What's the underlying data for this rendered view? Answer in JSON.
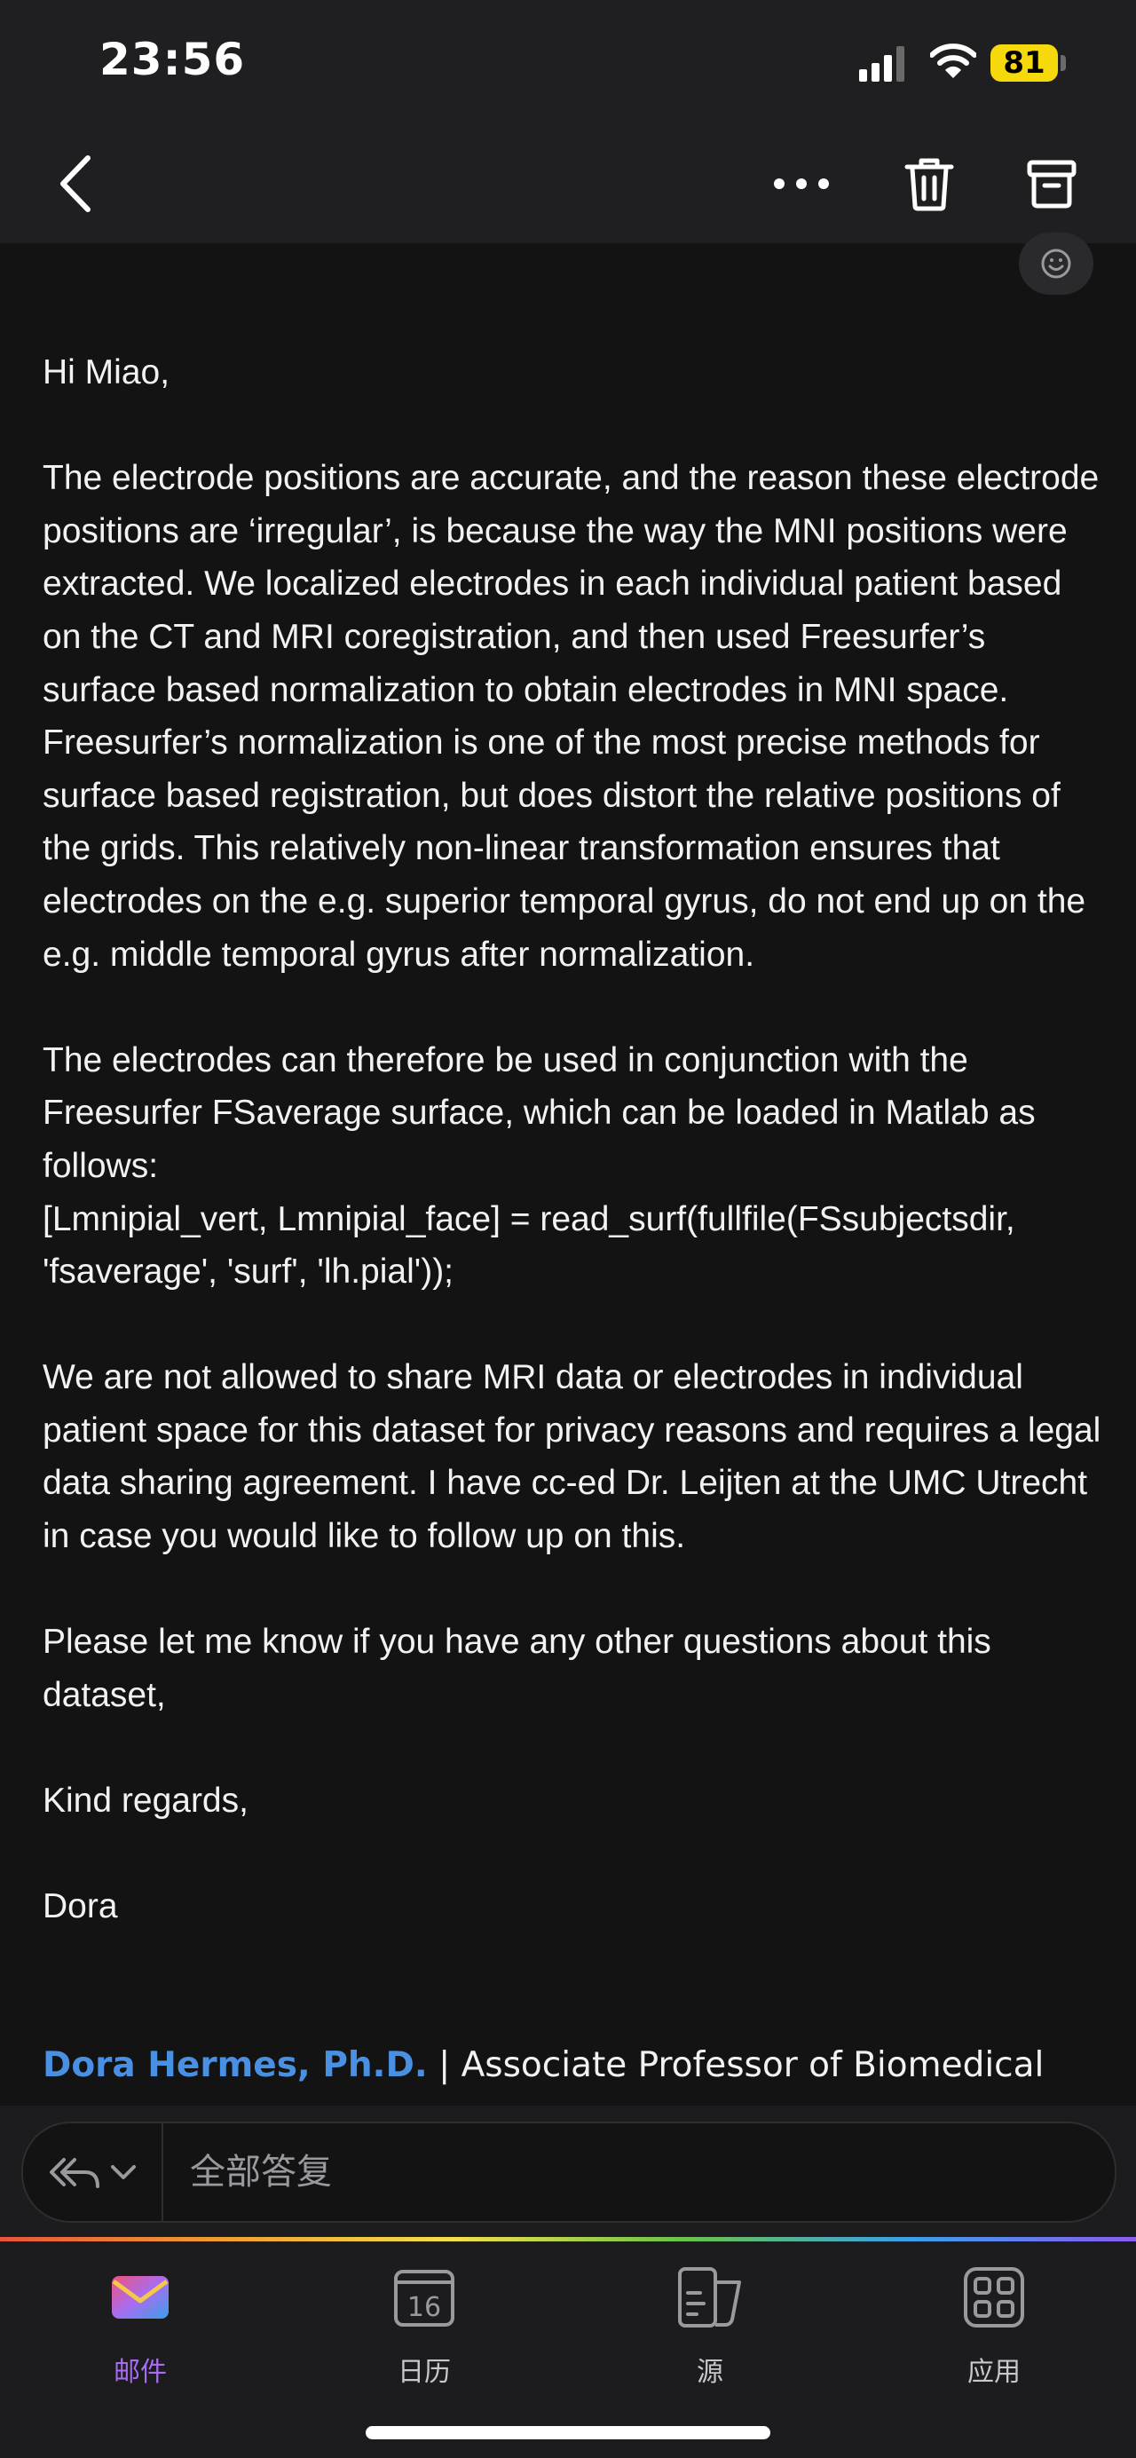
{
  "status_bar": {
    "time": "23:56",
    "battery": "81"
  },
  "nav": {
    "back": "back-icon",
    "more": "more-icon",
    "trash": "trash-icon",
    "archive": "archive-icon"
  },
  "email": {
    "greeting": "Hi Miao,",
    "p1": "The electrode positions are accurate, and the reason these electrode positions are ‘irregular’, is because the way the MNI positions were extracted. We localized electrodes in each individual patient based on the CT and MRI coregistration, and then used Freesurfer’s surface based normalization to obtain electrodes in MNI space. Freesurfer’s normalization is one of the most precise methods for surface based registration, but does distort the relative positions of the grids. This relatively non-linear transformation ensures that electrodes on the e.g. superior temporal gyrus, do not end up on the e.g. middle temporal gyrus after normalization.",
    "p2": "The electrodes can therefore be used in conjunction with the Freesurfer FSaverage surface, which can be loaded in Matlab as follows:",
    "code": "[Lmnipial_vert, Lmnipial_face] = read_surf(fullfile(FSsubjectsdir, 'fsaverage', 'surf', 'lh.pial'));",
    "p3": "We are not allowed to share MRI data or electrodes in individual patient space for this dataset for privacy reasons and requires a legal data sharing agreement. I have cc-ed Dr. Leijten at the UMC Utrecht in case you would like to follow up on this.",
    "p4": "Please let me know if you have any other questions about this dataset,",
    "closing": "Kind regards,",
    "signoff": "Dora",
    "signature_name": "Dora Hermes, Ph.D.",
    "signature_sep": " | ",
    "signature_title": "Associate Professor of Biomedical"
  },
  "reply": {
    "label": "全部答复"
  },
  "tabs": [
    {
      "label": "邮件",
      "icon": "mail-icon",
      "active": true
    },
    {
      "label": "日历",
      "icon": "calendar-icon",
      "day": "16"
    },
    {
      "label": "源",
      "icon": "feed-icon"
    },
    {
      "label": "应用",
      "icon": "apps-icon"
    }
  ],
  "colors": {
    "accent": "#a86cf0",
    "link": "#4a90e2",
    "battery": "#f5d90a"
  }
}
